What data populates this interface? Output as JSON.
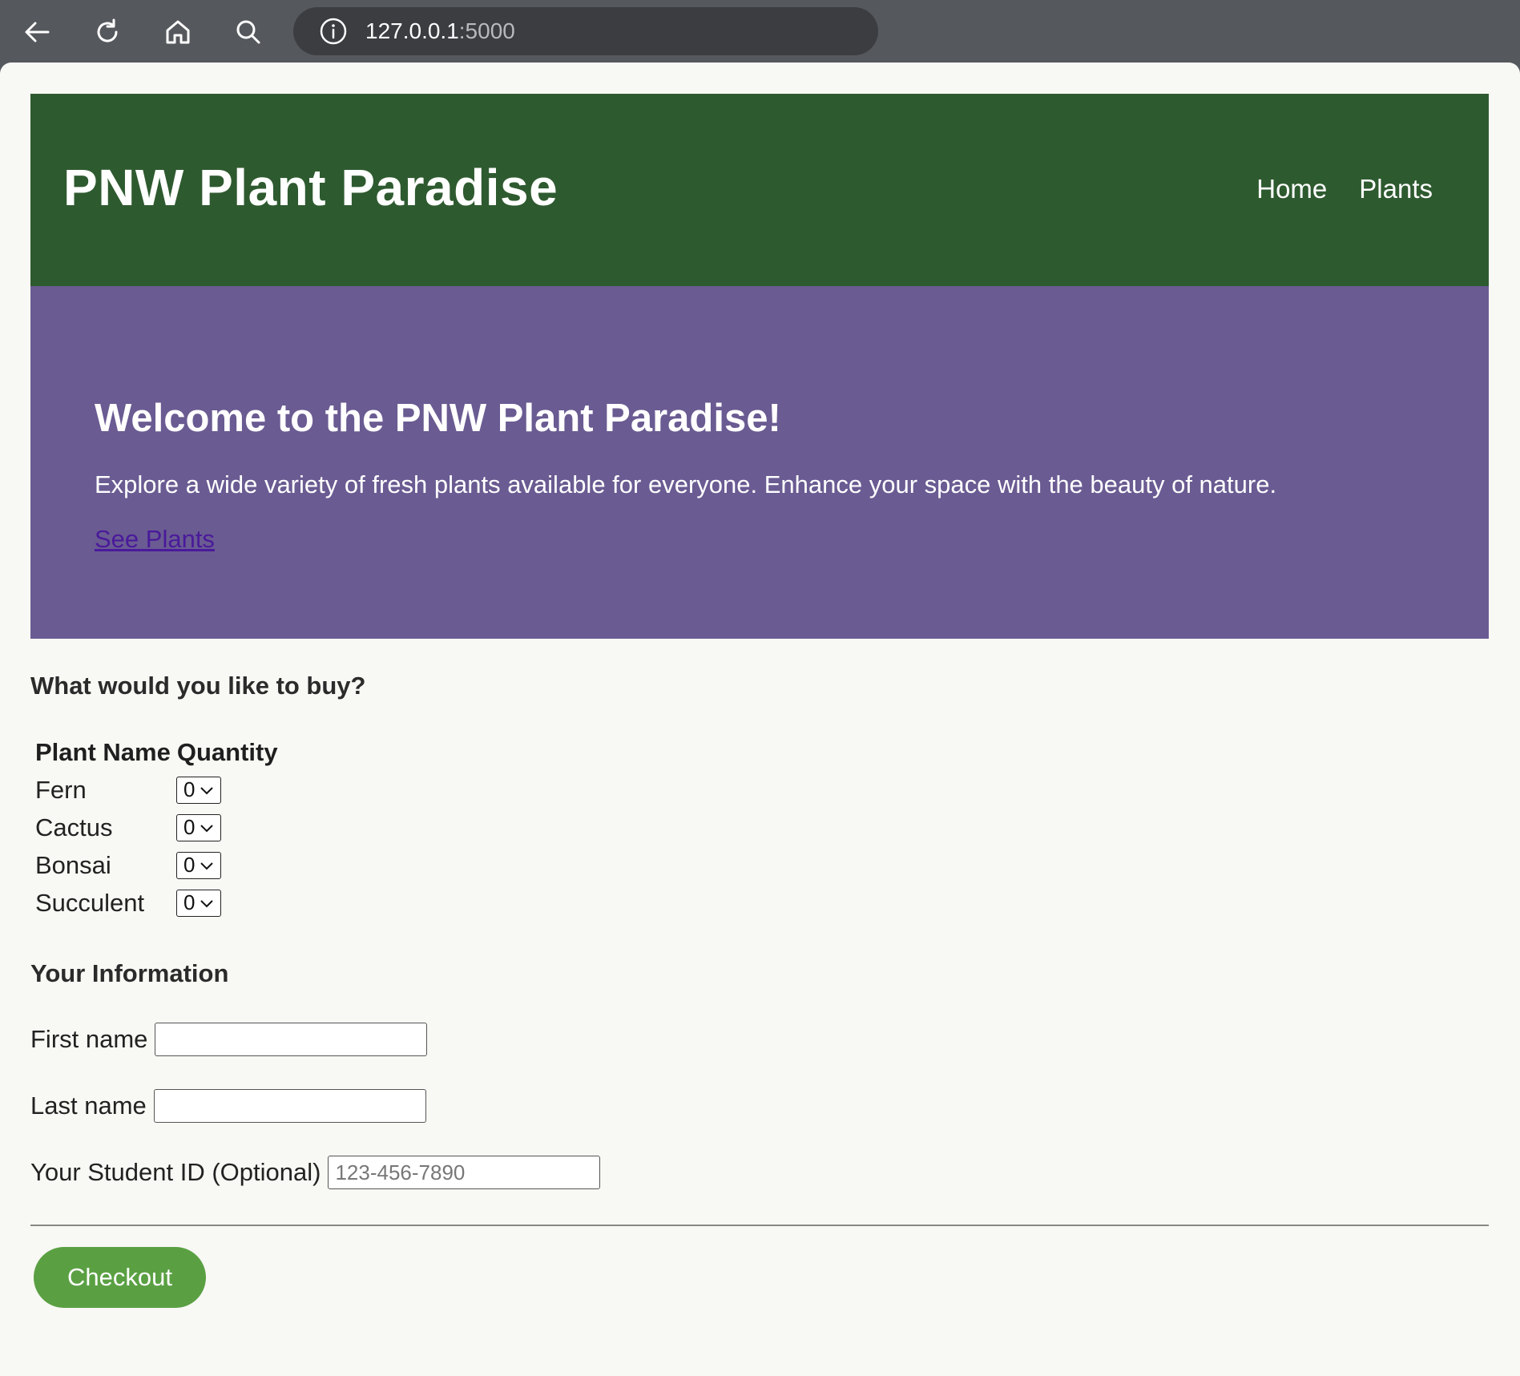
{
  "browser": {
    "url_host": "127.0.0.1",
    "url_port": ":5000"
  },
  "header": {
    "title": "PNW Plant Paradise",
    "nav": [
      {
        "label": "Home"
      },
      {
        "label": "Plants"
      }
    ]
  },
  "hero": {
    "title": "Welcome to the PNW Plant Paradise!",
    "text": "Explore a wide variety of fresh plants available for everyone. Enhance your space with the beauty of nature.",
    "link_label": "See Plants"
  },
  "order": {
    "heading": "What would you like to buy?",
    "columns": [
      "Plant Name",
      "Quantity"
    ],
    "plants": [
      {
        "name": "Fern",
        "quantity": "0"
      },
      {
        "name": "Cactus",
        "quantity": "0"
      },
      {
        "name": "Bonsai",
        "quantity": "0"
      },
      {
        "name": "Succulent",
        "quantity": "0"
      }
    ]
  },
  "info": {
    "heading": "Your Information",
    "first_name_label": "First name",
    "first_name_value": "",
    "last_name_label": "Last name",
    "last_name_value": "",
    "student_id_label": "Your Student ID (Optional)",
    "student_id_placeholder": "123-456-7890"
  },
  "checkout_label": "Checkout",
  "colors": {
    "header_bg": "#2e5a2f",
    "hero_bg": "#6a5b92",
    "checkout_bg": "#5aa043",
    "link": "#4a1a9a"
  },
  "icons": [
    "back-arrow-icon",
    "reload-icon",
    "home-icon",
    "search-icon",
    "info-icon",
    "chevron-down-icon"
  ]
}
